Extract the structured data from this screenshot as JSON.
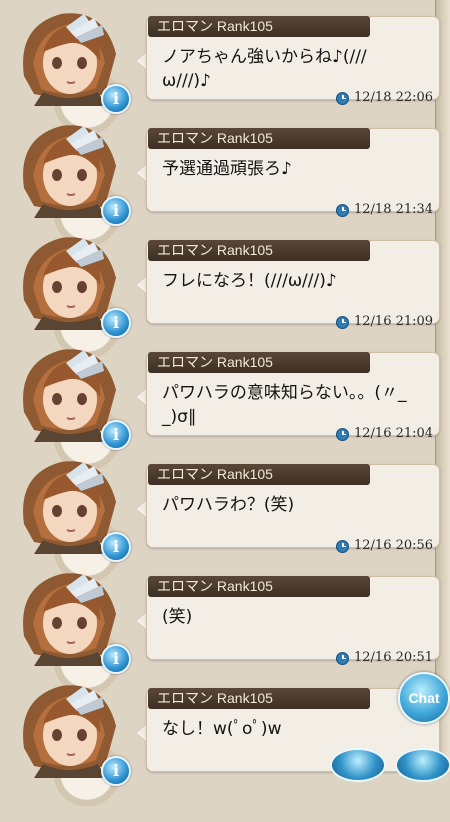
{
  "chat": {
    "button_label": "Chat",
    "messages": [
      {
        "name": "エロマン Rank105",
        "text": "ノアちゃん強いからね♪(///ω///)♪",
        "time": "12/18 22:06"
      },
      {
        "name": "エロマン Rank105",
        "text": "予選通過頑張ろ♪",
        "time": "12/18 21:34"
      },
      {
        "name": "エロマン Rank105",
        "text": "フレになろ！(///ω///)♪",
        "time": "12/16 21:09"
      },
      {
        "name": "エロマン Rank105",
        "text": "パワハラの意味知らない。。(〃_ _)σ∥",
        "time": "12/16 21:04"
      },
      {
        "name": "エロマン Rank105",
        "text": "パワハラわ？(笑)",
        "time": "12/16 20:56"
      },
      {
        "name": "エロマン Rank105",
        "text": "(笑)",
        "time": "12/16 20:51"
      },
      {
        "name": "エロマン Rank105",
        "text": "なし！w(ﾟoﾟ)w",
        "time": ""
      }
    ]
  },
  "icons": {
    "avatar": "character-avatar-icon",
    "info": "info-icon",
    "time": "clock-icon"
  },
  "colors": {
    "name_bar": "#4b3b2f",
    "bubble": "#f2eee5",
    "accent": "#2e7db8"
  }
}
